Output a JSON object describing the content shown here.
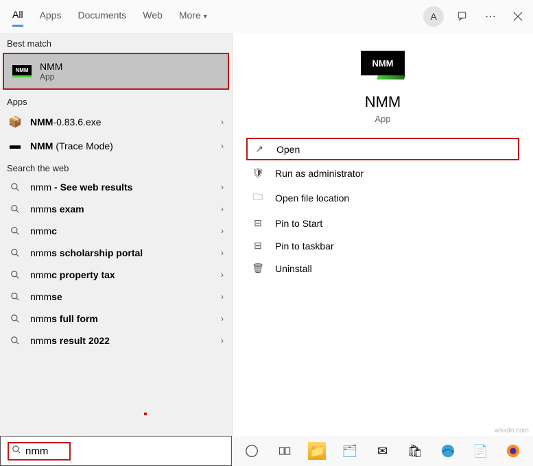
{
  "header": {
    "tabs": [
      "All",
      "Apps",
      "Documents",
      "Web",
      "More"
    ],
    "avatar_initial": "A"
  },
  "left": {
    "best_match_label": "Best match",
    "best_match": {
      "title": "NMM",
      "subtitle": "App"
    },
    "apps_label": "Apps",
    "apps": [
      {
        "prefix": "NMM",
        "suffix": "-0.83.6.exe"
      },
      {
        "prefix": "NMM",
        "suffix": " (Trace Mode)"
      }
    ],
    "web_label": "Search the web",
    "web": [
      {
        "bold": "nmm",
        "rest": " - See web results"
      },
      {
        "bold": "nmm",
        "rest": "s exam"
      },
      {
        "bold": "nmm",
        "rest": "c"
      },
      {
        "bold": "nmm",
        "rest": "s scholarship portal"
      },
      {
        "bold": "nmm",
        "rest": "c property tax"
      },
      {
        "bold": "nmm",
        "rest": "se"
      },
      {
        "bold": "nmm",
        "rest": "s full form"
      },
      {
        "bold": "nmm",
        "rest": "s result 2022"
      }
    ]
  },
  "right": {
    "title": "NMM",
    "subtitle": "App",
    "actions": [
      {
        "label": "Open",
        "icon": "↗",
        "highlighted": true
      },
      {
        "label": "Run as administrator",
        "icon": "🛡"
      },
      {
        "label": "Open file location",
        "icon": "🗀"
      },
      {
        "label": "Pin to Start",
        "icon": "⊟"
      },
      {
        "label": "Pin to taskbar",
        "icon": "⊟"
      },
      {
        "label": "Uninstall",
        "icon": "🗑"
      }
    ]
  },
  "search": {
    "value": "nmm"
  },
  "watermark": "wsxdn.com"
}
